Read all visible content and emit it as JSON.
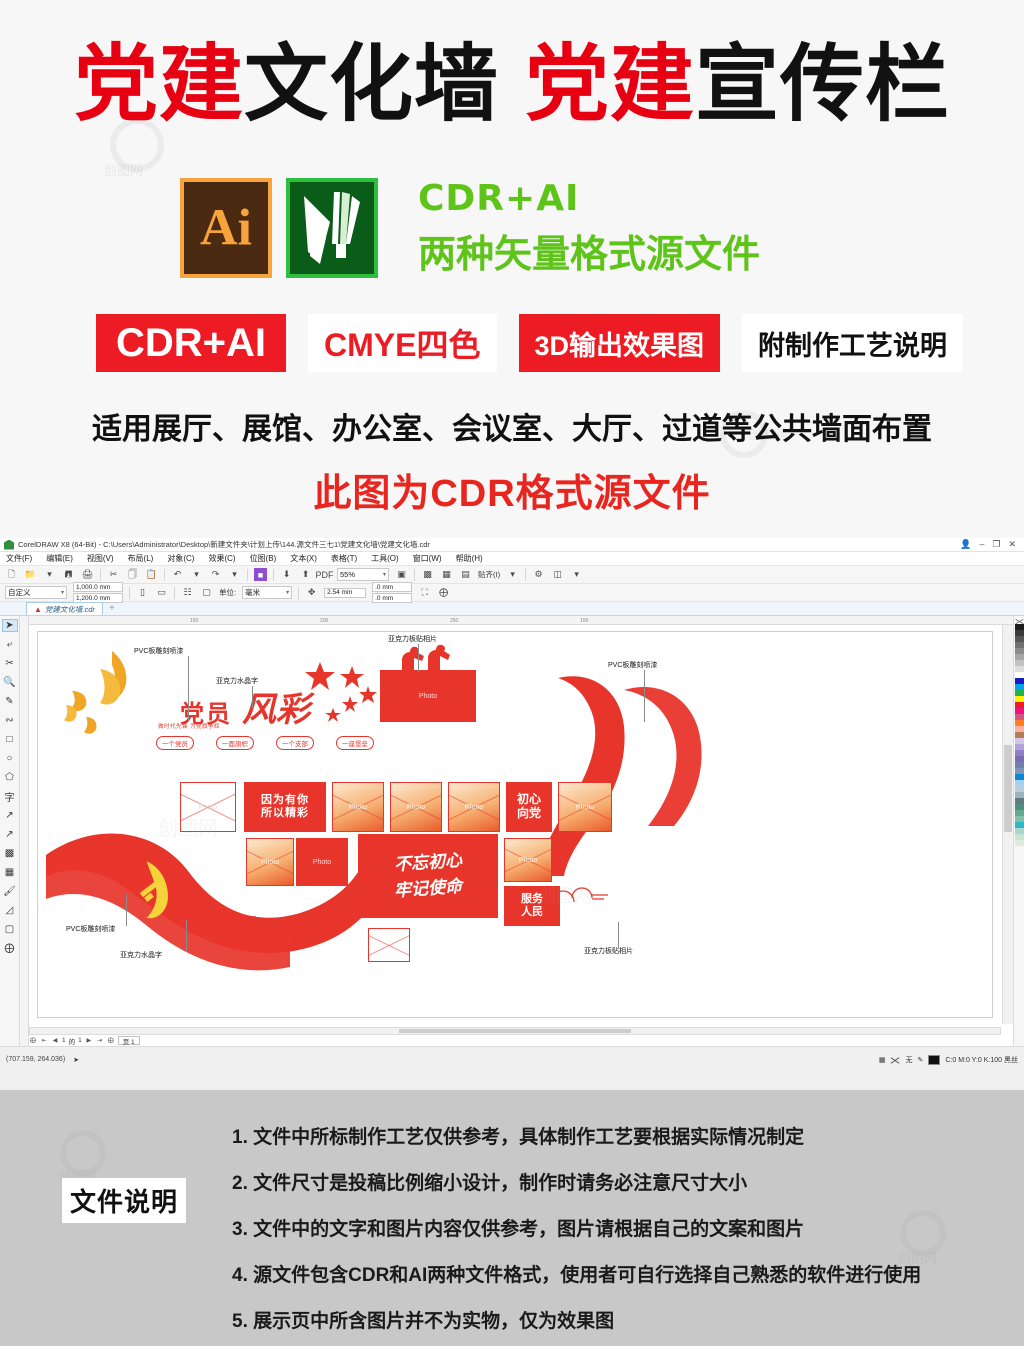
{
  "promo": {
    "title": [
      {
        "text": "党建",
        "color": "red"
      },
      {
        "text": "文化墙",
        "color": "black"
      },
      {
        "text": "党建",
        "color": "red"
      },
      {
        "text": "宣传栏",
        "color": "black"
      }
    ],
    "icons": {
      "ai_label": "Ai",
      "ai_name": "adobe-illustrator-icon",
      "cdr_name": "coreldraw-icon"
    },
    "format_line1": "CDR+AI",
    "format_line2": "两种矢量格式源文件",
    "badges": [
      {
        "label": "CDR+AI",
        "style": "fill-red"
      },
      {
        "label": "CMYE四色",
        "style": "white-red"
      },
      {
        "label": "3D输出效果图",
        "style": "fill-red"
      },
      {
        "label": "附制作工艺说明",
        "style": "white-black"
      }
    ],
    "suitable": "适用展厅、展馆、办公室、会议室、大厅、过道等公共墙面布置",
    "cdr_note": "此图为CDR格式源文件",
    "colors": {
      "red": "#e60012",
      "badge_red": "#ed1c24",
      "green": "#5fc41a",
      "black": "#111111"
    }
  },
  "app": {
    "title": "CorelDRAW X8 (64-Bit) - C:\\Users\\Administrator\\Desktop\\新建文件夹\\计划上传\\144.源文件三七1\\党建文化墙\\党建文化墙.cdr",
    "window_controls": [
      "🗕",
      "🗗",
      "🗙"
    ],
    "menus": [
      "文件(F)",
      "编辑(E)",
      "视图(V)",
      "布局(L)",
      "对象(C)",
      "效果(C)",
      "位图(B)",
      "文本(X)",
      "表格(T)",
      "工具(O)",
      "窗口(W)",
      "帮助(H)"
    ],
    "toolbar": {
      "zoom_level": "55%",
      "snap_label": "贴齐(I)",
      "preset_name": "自定义",
      "page_width": "1,000.0 mm",
      "page_height": "1,200.0 mm",
      "unit_label": "单位:",
      "unit_value": "毫米",
      "nudge": "2.54 mm",
      "duplicate_x": ".0 mm",
      "duplicate_y": ".0 mm"
    },
    "document_tab": "党建文化墙.cdr",
    "toolbox": [
      "pick-tool",
      "shape-tool",
      "crop-tool",
      "zoom-tool",
      "freehand-tool",
      "artistic-media-tool",
      "rectangle-tool",
      "ellipse-tool",
      "polygon-tool",
      "text-tool",
      "parallel-dimension-tool",
      "straight-line-connector-tool",
      "drop-shadow-tool",
      "transparency-tool",
      "color-eyedropper-tool",
      "interactive-fill-tool",
      "smart-fill-tool",
      "quick-customize"
    ],
    "pagenav": {
      "current": "1",
      "of_label": "的",
      "total": "1",
      "page_tab": "页 1"
    },
    "statusbar": {
      "coords": "(707.159, 264.036)",
      "fill_label": "无",
      "outline_color": "C:0 M:0 Y:0 K:100 黑丝"
    },
    "ruler_ticks": [
      "150",
      "200",
      "250",
      "100"
    ]
  },
  "artwork": {
    "annotations": [
      {
        "label": "PVC板雕刻喷漆",
        "id": "anno-pvc-top-left"
      },
      {
        "label": "亚克力板贴相片",
        "id": "anno-acrylic-photo-top"
      },
      {
        "label": "PVC板雕刻喷漆",
        "id": "anno-pvc-top-right"
      },
      {
        "label": "亚克力水晶字",
        "id": "anno-crystal-text-top"
      },
      {
        "label": "PVC板雕刻喷漆",
        "id": "anno-pvc-bottom-left"
      },
      {
        "label": "亚克力水晶字",
        "id": "anno-crystal-text-bottom"
      },
      {
        "label": "亚克力板贴相片",
        "id": "anno-acrylic-photo-bottom"
      }
    ],
    "headline_main": "党员",
    "headline_accent": "风彩",
    "headline_sub": "做时代先锋 为党旗争辉",
    "pills": [
      "一个党员",
      "一面旗帜",
      "一个支部",
      "一座堡垒"
    ],
    "panel_yinwei": [
      "因为有你",
      "所以精彩"
    ],
    "panel_chuxin": [
      "初心",
      "向党"
    ],
    "panel_slogan": [
      "不忘初心",
      "牢记使命"
    ],
    "panel_fuwu": [
      "服务",
      "人民"
    ],
    "photo_placeholder": "Photo",
    "colors": {
      "red": "#e8352b",
      "gold": "#f0a625"
    }
  },
  "footer": {
    "label": "文件说明",
    "notes": [
      "1. 文件中所标制作工艺仅供参考，具体制作工艺要根据实际情况制定",
      "2. 文件尺寸是投稿比例缩小设计，制作时请务必注意尺寸大小",
      "3. 文件中的文字和图片内容仅供参考，图片请根据自己的文案和图片",
      "4. 源文件包含CDR和AI两种文件格式，使用者可自行选择自己熟悉的软件进行使用",
      "5. 展示页中所含图片并不为实物，仅为效果图"
    ],
    "bg_color": "#c8c8c8"
  }
}
